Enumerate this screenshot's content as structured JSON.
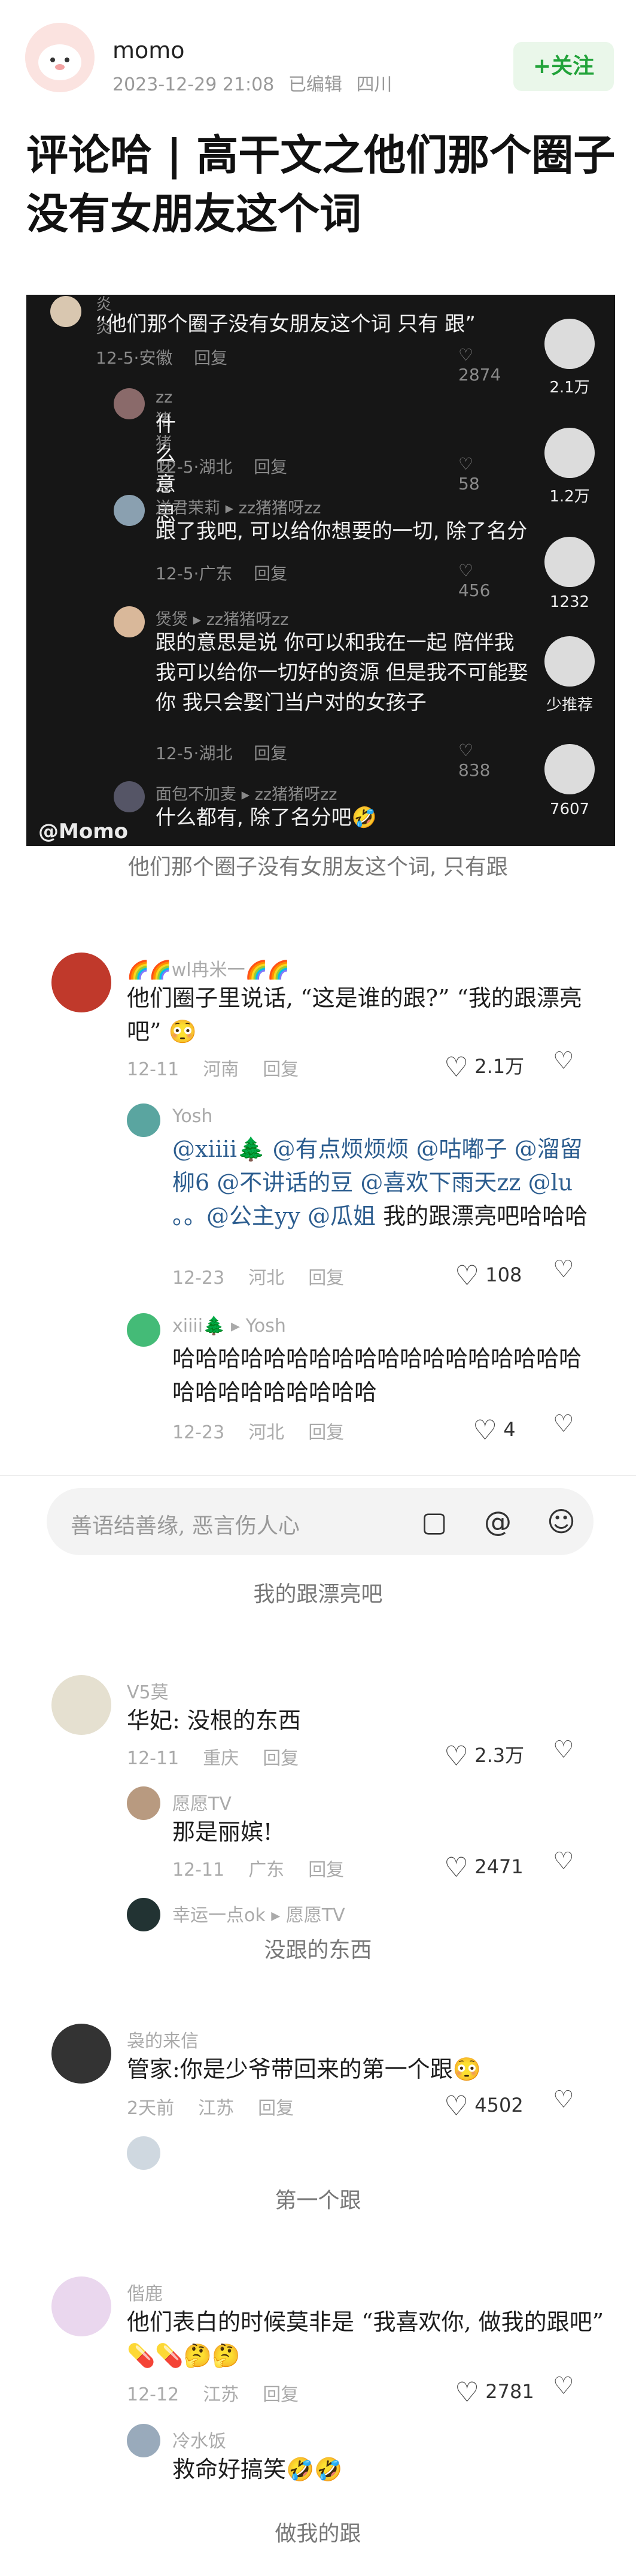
{
  "header": {
    "author": "momo",
    "date": "2023-12-29 21:08",
    "edited": "已编辑",
    "location": "四川",
    "follow_label": "+关注",
    "title": "评论哈 | 高干文之他们那个圈子没有女朋友这个词"
  },
  "shot": {
    "c1": {
      "name": "炎炎",
      "text": "“他们那个圈子没有女朋友这个词 只有 跟”",
      "date": "12-5·安徽",
      "reply": "回复",
      "likes": "2874"
    },
    "c2": {
      "name": "zz猪猪呀zz",
      "text": "什么意思",
      "date": "12-5·湖北",
      "reply": "回复",
      "likes": "58"
    },
    "c3": {
      "name": "送君茉莉 ▸ zz猪猪呀zz",
      "text": "跟了我吧, 可以给你想要的一切, 除了名分",
      "date": "12-5·广东",
      "reply": "回复",
      "likes": "456"
    },
    "c4": {
      "name": "煲煲 ▸ zz猪猪呀zz",
      "text": "跟的意思是说 你可以和我在一起 陪伴我 我可以给你一切好的资源 但是我不可能娶你 我只会娶门当户对的女孩子",
      "date": "12-5·湖北",
      "reply": "回复",
      "likes": "838"
    },
    "c5": {
      "name": "面包不加麦 ▸ zz猪猪呀zz",
      "text": "什么都有, 除了名分吧🤣"
    },
    "watermark": "@Momo",
    "side": [
      {
        "label": "2.1万"
      },
      {
        "label": "1.2万"
      },
      {
        "label": "1232"
      },
      {
        "label": "少推荐"
      },
      {
        "label": "7607"
      }
    ],
    "caption": "他们那个圈子没有女朋友这个词, 只有跟"
  },
  "thread1": {
    "c1": {
      "name": "🌈🌈wl冉米一🌈🌈",
      "text": "他们圈子里说话, “这是谁的跟?” “我的跟漂亮吧” 😳",
      "date": "12-11",
      "loc": "河南",
      "reply": "回复",
      "likes": "2.1万"
    },
    "c2": {
      "name": "Yosh",
      "mentions": "@xiiii🌲 @有点烦烦烦 @咕嘟子 @溜留柳6 @不讲话的豆 @喜欢下雨天zz @lu 。。@公主yy @瓜姐",
      "tail": " 我的跟漂亮吧哈哈哈",
      "date": "12-23",
      "loc": "河北",
      "reply": "回复",
      "likes": "108"
    },
    "c3": {
      "name": "xiiii🌲 ▸ Yosh",
      "text": "哈哈哈哈哈哈哈哈哈哈哈哈哈哈哈哈哈哈哈哈哈哈哈哈哈哈哈",
      "date": "12-23",
      "loc": "河北",
      "reply": "回复",
      "likes": "4"
    },
    "input_placeholder": "善语结善缘, 恶言伤人心",
    "caption": "我的跟漂亮吧"
  },
  "thread2": {
    "c1": {
      "name": "V5莫",
      "text": "华妃: 没根的东西",
      "date": "12-11",
      "loc": "重庆",
      "reply": "回复",
      "likes": "2.3万"
    },
    "c2": {
      "name": "愿愿TV",
      "text": "那是丽嫔!",
      "date": "12-11",
      "loc": "广东",
      "reply": "回复",
      "likes": "2471"
    },
    "c3": {
      "name": "幸运一点ok ▸ 愿愿TV"
    },
    "caption": "没跟的东西"
  },
  "thread3": {
    "c1": {
      "name": "袅的来信",
      "text": "管家:你是少爷带回来的第一个跟😳",
      "date": "2天前",
      "loc": "江苏",
      "reply": "回复",
      "likes": "4502"
    },
    "caption": "第一个跟"
  },
  "thread4": {
    "c1": {
      "name": "偕鹿",
      "text": "他们表白的时候莫非是 “我喜欢你, 做我的跟吧” 💊💊🤔🤔",
      "date": "12-12",
      "loc": "江苏",
      "reply": "回复",
      "likes": "2781"
    },
    "c2": {
      "name": "冷水饭",
      "text": "救命好搞笑🤣🤣"
    },
    "caption": "做我的跟"
  },
  "colors": {
    "follow_bg": "#eaf7ea",
    "follow_text": "#22a33a",
    "mention": "#2c5d8f",
    "panel": "#161616"
  }
}
